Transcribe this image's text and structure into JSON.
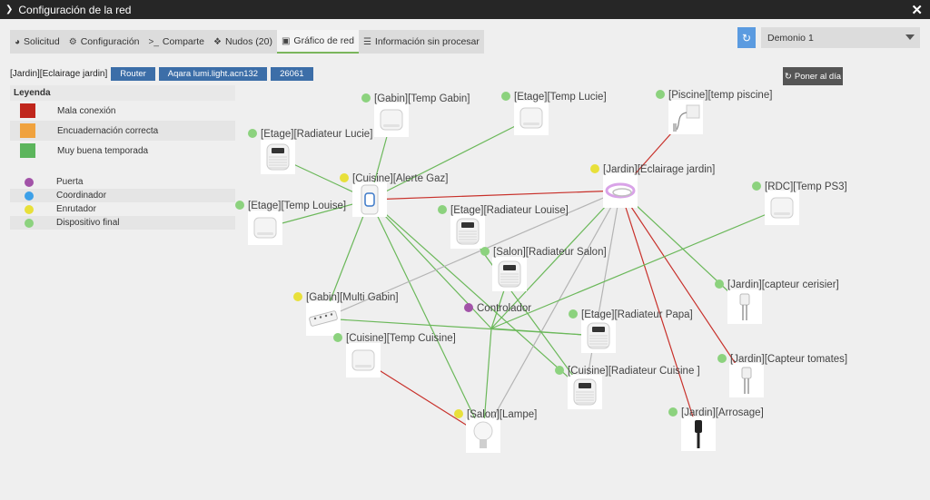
{
  "window": {
    "title": "Configuración de la red"
  },
  "tabs": [
    {
      "label": "Solicitud",
      "icon": "dashboard-icon"
    },
    {
      "label": "Configuración",
      "icon": "gears-icon"
    },
    {
      "label": "Comparte",
      "icon": "terminal-icon"
    },
    {
      "label": "Nudos (20)",
      "icon": "cubes-icon"
    },
    {
      "label": "Gráfico de red",
      "icon": "picture-icon",
      "active": true
    },
    {
      "label": "Información sin procesar",
      "icon": "list-icon"
    }
  ],
  "daemon_select": {
    "value": "Demonio 1"
  },
  "selected_node": {
    "name": "[Jardin][Eclairage jardin]",
    "type": "Router",
    "model": "Aqara lumi.light.acn132",
    "id": "26061"
  },
  "update_button": {
    "label": "Poner al día"
  },
  "legend": {
    "title": "Leyenda",
    "links": [
      {
        "label": "Mala conexión",
        "color": "#c0261c"
      },
      {
        "label": "Encuadernación correcta",
        "color": "#f0a23e"
      },
      {
        "label": "Muy buena temporada",
        "color": "#5cb55c"
      }
    ],
    "nodes": [
      {
        "label": "Puerta",
        "color": "#a253a8"
      },
      {
        "label": "Coordinador",
        "color": "#3da0e8"
      },
      {
        "label": "Enrutador",
        "color": "#e8e03a"
      },
      {
        "label": "Dispositivo final",
        "color": "#8cd27e"
      }
    ]
  },
  "graph": {
    "colors": {
      "bad": "#c8302a",
      "good": "#6bb85a",
      "neutral": "#b4b4b4"
    },
    "nodes": [
      {
        "id": "gabin_temp",
        "label": "[Gabin][Temp Gabin]",
        "role": "end",
        "device": "sensor-square"
      },
      {
        "id": "etage_temp_lucie",
        "label": "[Etage][Temp Lucie]",
        "role": "end",
        "device": "sensor-square"
      },
      {
        "id": "piscine",
        "label": "[Piscine][temp piscine]",
        "role": "end",
        "device": "probe"
      },
      {
        "id": "etage_rad_lucie",
        "label": "[Etage][Radiateur Lucie]",
        "role": "end",
        "device": "thermostat"
      },
      {
        "id": "cuisine_gaz",
        "label": "[Cuisine][Alerte Gaz]",
        "role": "router",
        "device": "gas-detector"
      },
      {
        "id": "jardin_eclairage",
        "label": "[Jardin][Eclairage jardin]",
        "role": "router",
        "device": "light-strip"
      },
      {
        "id": "rdc_ps3",
        "label": "[RDC][Temp PS3]",
        "role": "end",
        "device": "sensor-square"
      },
      {
        "id": "etage_temp_louise",
        "label": "[Etage][Temp Louise]",
        "role": "end",
        "device": "sensor-square"
      },
      {
        "id": "etage_rad_louise",
        "label": "[Etage][Radiateur Louise]",
        "role": "end",
        "device": "thermostat"
      },
      {
        "id": "salon_rad",
        "label": "[Salon][Radiateur Salon]",
        "role": "end",
        "device": "thermostat"
      },
      {
        "id": "jardin_cerisier",
        "label": "[Jardin][capteur cerisier]",
        "role": "end",
        "device": "soil-sensor"
      },
      {
        "id": "gabin_multi",
        "label": "[Gabin][Multi Gabin]",
        "role": "router",
        "device": "power-strip"
      },
      {
        "id": "controlador",
        "label": "Controlador",
        "role": "gateway",
        "device": "none"
      },
      {
        "id": "etage_rad_papa",
        "label": "[Etage][Radiateur Papa]",
        "role": "end",
        "device": "thermostat"
      },
      {
        "id": "cuisine_temp",
        "label": "[Cuisine][Temp Cuisine]",
        "role": "end",
        "device": "sensor-square"
      },
      {
        "id": "cuisine_rad",
        "label": "[Cuisine][Radiateur Cuisine ]",
        "role": "end",
        "device": "thermostat"
      },
      {
        "id": "jardin_tomates",
        "label": "[Jardin][Capteur tomates]",
        "role": "end",
        "device": "soil-sensor"
      },
      {
        "id": "salon_lampe",
        "label": "[Salon][Lampe]",
        "role": "router",
        "device": "bulb"
      },
      {
        "id": "jardin_arrosage",
        "label": "[Jardin][Arrosage]",
        "role": "end",
        "device": "valve"
      }
    ],
    "links": [
      {
        "from": "gabin_temp",
        "to": "cuisine_gaz",
        "quality": "good"
      },
      {
        "from": "etage_temp_lucie",
        "to": "cuisine_gaz",
        "quality": "good"
      },
      {
        "from": "etage_rad_lucie",
        "to": "cuisine_gaz",
        "quality": "good"
      },
      {
        "from": "piscine",
        "to": "jardin_eclairage",
        "quality": "bad"
      },
      {
        "from": "cuisine_gaz",
        "to": "jardin_eclairage",
        "quality": "bad"
      },
      {
        "from": "cuisine_gaz",
        "to": "etage_temp_louise",
        "quality": "good"
      },
      {
        "from": "cuisine_gaz",
        "to": "gabin_multi",
        "quality": "good"
      },
      {
        "from": "cuisine_gaz",
        "to": "controlador",
        "quality": "good"
      },
      {
        "from": "cuisine_gaz",
        "to": "salon_lampe",
        "quality": "good"
      },
      {
        "from": "cuisine_gaz",
        "to": "cuisine_rad",
        "quality": "good"
      },
      {
        "from": "jardin_eclairage",
        "to": "jardin_cerisier",
        "quality": "good"
      },
      {
        "from": "jardin_eclairage",
        "to": "jardin_tomates",
        "quality": "bad"
      },
      {
        "from": "jardin_eclairage",
        "to": "jardin_arrosage",
        "quality": "bad"
      },
      {
        "from": "jardin_eclairage",
        "to": "controlador",
        "quality": "good"
      },
      {
        "from": "jardin_eclairage",
        "to": "salon_lampe",
        "quality": "neutral"
      },
      {
        "from": "jardin_eclairage",
        "to": "cuisine_rad",
        "quality": "neutral"
      },
      {
        "from": "jardin_eclairage",
        "to": "gabin_multi",
        "quality": "neutral"
      },
      {
        "from": "rdc_ps3",
        "to": "controlador",
        "quality": "good"
      },
      {
        "from": "etage_rad_louise",
        "to": "cuisine_rad",
        "quality": "good"
      },
      {
        "from": "salon_rad",
        "to": "controlador",
        "quality": "good"
      },
      {
        "from": "gabin_multi",
        "to": "etage_rad_papa",
        "quality": "good"
      },
      {
        "from": "controlador",
        "to": "etage_rad_papa",
        "quality": "good"
      },
      {
        "from": "controlador",
        "to": "salon_lampe",
        "quality": "good"
      },
      {
        "from": "cuisine_temp",
        "to": "salon_lampe",
        "quality": "bad"
      }
    ]
  }
}
